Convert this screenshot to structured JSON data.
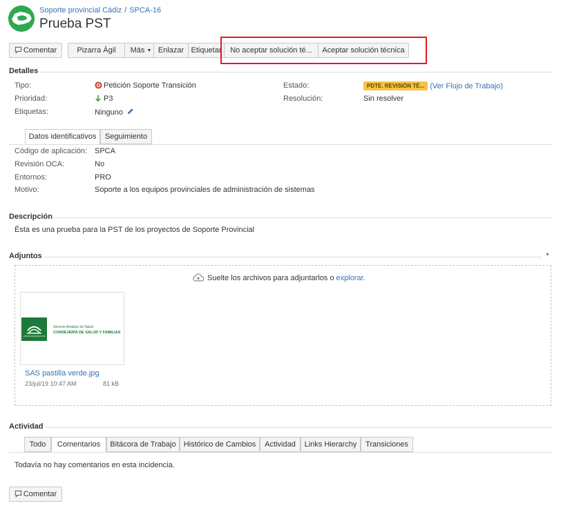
{
  "header": {
    "breadcrumb_project": "Soporte provincial Cádiz",
    "breadcrumb_sep": "/",
    "breadcrumb_issue": "SPCA-16",
    "title": "Prueba PST"
  },
  "toolbar": {
    "comment": "Comentar",
    "agile_board": "Pizarra Ágil",
    "more": "Más",
    "link": "Enlazar",
    "label": "Etiquetar",
    "reject": "No aceptar solución té...",
    "accept": "Aceptar solución técnica"
  },
  "details": {
    "title": "Detalles",
    "type_label": "Tipo:",
    "type_value": "Petición Soporte Transición",
    "priority_label": "Prioridad:",
    "priority_value": "P3",
    "labels_label": "Etiquetas:",
    "labels_value": "Ninguno",
    "status_label": "Estado:",
    "status_value": "PDTE. REVISIÓN TÉ...",
    "workflow_link": "(Ver Flujo de Trabajo)",
    "resolution_label": "Resolución:",
    "resolution_value": "Sin resolver"
  },
  "detail_tabs": [
    "Datos identificativos",
    "Seguimiento"
  ],
  "fields": [
    {
      "label": "Código de aplicación:",
      "value": "SPCA"
    },
    {
      "label": "Revisión OCA:",
      "value": "No"
    },
    {
      "label": "Entornos:",
      "value": "PRO"
    },
    {
      "label": "Motivo:",
      "value": "Soporte a los equipos provinciales de administración de sistemas"
    }
  ],
  "description": {
    "title": "Descripción",
    "text": "Ésta es una prueba para la PST de los proyectos de Soporte Provincial"
  },
  "attachments": {
    "title": "Adjuntos",
    "drop_text": "Suelte los archivos para adjuntarlos o",
    "browse_link": "explorar.",
    "file": {
      "name": "SAS pastilla verde.jpg",
      "date": "23/jul/19 10:47 AM",
      "size": "81 kB",
      "logo_line1": "Servicio Andaluz de Salud",
      "logo_line2": "CONSEJERÍA DE SALUD Y FAMILIAS",
      "logo_caption": "JUNTA DE ANDALUCIA"
    }
  },
  "activity": {
    "title": "Actividad",
    "tabs": [
      "Todo",
      "Comentarios",
      "Bitácora de Trabajo",
      "Histórico de Cambios",
      "Actividad",
      "Links Hierarchy",
      "Transiciones"
    ],
    "empty_text": "Todavía no hay comentarios en esta incidencia.",
    "comment_button": "Comentar"
  },
  "colors": {
    "accent": "#3572b0",
    "highlight": "#e8161b",
    "status": "#f6c342",
    "brand_green": "#2fa84f"
  }
}
